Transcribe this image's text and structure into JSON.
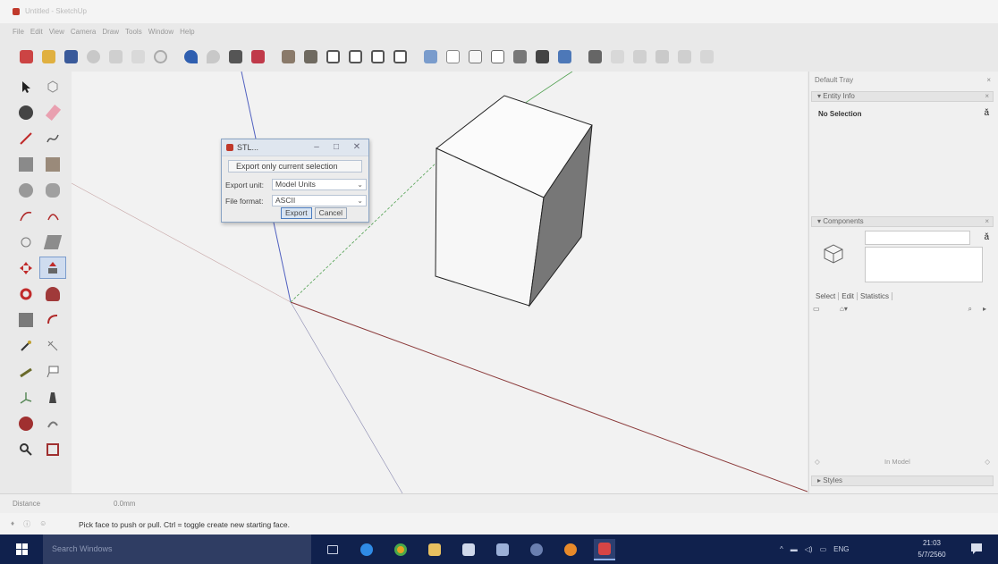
{
  "window": {
    "title": "Untitled - SketchUp"
  },
  "menu": [
    "File",
    "Edit",
    "View",
    "Camera",
    "Draw",
    "Tools",
    "Window",
    "Help"
  ],
  "toolbar": {
    "icons": [
      "getting-started-icon",
      "open-icon",
      "save-icon",
      "cut-icon",
      "copy-icon",
      "paste-icon",
      "erase-icon",
      "undo-icon",
      "redo-icon",
      "print-icon",
      "model-info-icon",
      "iso-view-icon",
      "top-view-icon",
      "front-view-icon",
      "right-view-icon",
      "back-view-icon",
      "left-view-icon",
      "xray-icon",
      "wireframe-icon",
      "hidden-line-icon",
      "shaded-icon",
      "shaded-texture-icon",
      "monochrome-icon",
      "warehouse-icon",
      "share-model-icon",
      "extension-icon",
      "layout-icon",
      "component-icon",
      "style-icon"
    ]
  },
  "dialog": {
    "title": "STL...",
    "checkbox_label": "Export only current selection",
    "unit_label": "Export unit:",
    "unit_value": "Model Units",
    "format_label": "File format:",
    "format_value": "ASCII",
    "export_label": "Export",
    "cancel_label": "Cancel"
  },
  "tray": {
    "title": "Default Tray",
    "entity_info": {
      "header": "Entity Info",
      "selection": "No Selection"
    },
    "components": {
      "header": "Components",
      "tabs": [
        "Select",
        "Edit",
        "Statistics"
      ],
      "in_model": "In Model"
    },
    "styles": {
      "header": "Styles"
    }
  },
  "measurements": {
    "label": "Distance",
    "value": "0.0mm"
  },
  "status": {
    "message": "Pick face to push or pull. Ctrl = toggle create new starting face."
  },
  "taskbar": {
    "search_placeholder": "Search Windows",
    "language": "ENG",
    "time": "21:03",
    "date": "5/7/2560"
  },
  "colors": {
    "taskbar": "#10214d",
    "dialog_border": "#8aa4c4",
    "axis_red": "#c05050",
    "axis_green": "#50a050",
    "axis_blue": "#5060c0"
  }
}
